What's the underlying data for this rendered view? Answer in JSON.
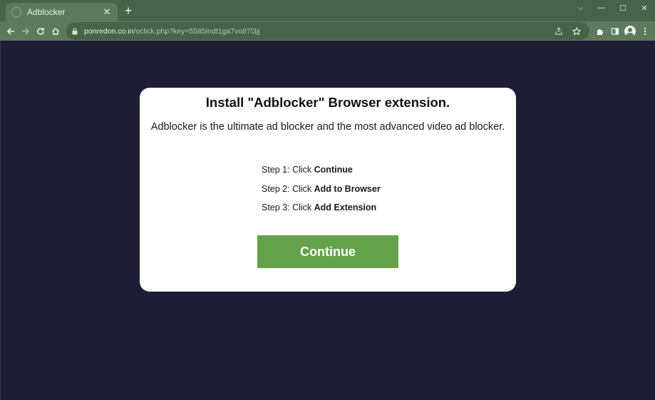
{
  "browser": {
    "tab": {
      "title": "Adblocker"
    },
    "url": {
      "host": "ponredon.co.in",
      "path": "/oclick.php?key=5585lndt1ga7vo87l3jj"
    },
    "window_controls": {
      "dropdown": "⌵",
      "minimize": "—",
      "maximize": "☐",
      "close": "✕"
    }
  },
  "page": {
    "title": "Install \"Adblocker\" Browser extension.",
    "subtitle": "Adblocker is the ultimate ad blocker and the most advanced video ad blocker.",
    "steps": [
      {
        "prefix": "Step 1: Click ",
        "action": "Continue"
      },
      {
        "prefix": "Step 2: Click ",
        "action": "Add to Browser"
      },
      {
        "prefix": "Step 3: Click ",
        "action": "Add Extension"
      }
    ],
    "button_label": "Continue"
  },
  "colors": {
    "frame": "#48634a",
    "toolbar": "#5d7a5e",
    "page_bg": "#1d1d33",
    "button": "#63a24b"
  },
  "icons": [
    "globe-icon",
    "close-icon",
    "plus-icon",
    "back-arrow-icon",
    "forward-arrow-icon",
    "reload-icon",
    "home-icon",
    "lock-icon",
    "share-icon",
    "star-icon",
    "puzzle-icon",
    "side-panel-icon",
    "profile-icon",
    "kebab-menu-icon"
  ]
}
